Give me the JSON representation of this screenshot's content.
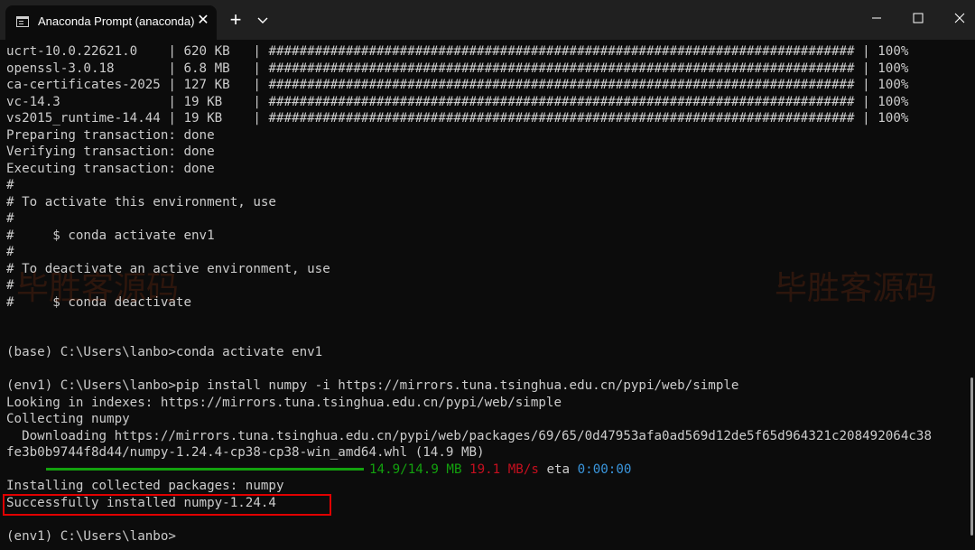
{
  "tab": {
    "title": "Anaconda Prompt (anaconda)",
    "close": "✕"
  },
  "titlebar": {
    "new_tab": "+"
  },
  "packages": [
    {
      "name": "ucrt-10.0.22621.0   ",
      "size": "620 KB   ",
      "bar": "############################################################################",
      "percent": "100%"
    },
    {
      "name": "openssl-3.0.18      ",
      "size": "6.8 MB   ",
      "bar": "############################################################################",
      "percent": "100%"
    },
    {
      "name": "ca-certificates-2025",
      "size": "127 KB   ",
      "bar": "############################################################################",
      "percent": "100%"
    },
    {
      "name": "vc-14.3             ",
      "size": "19 KB    ",
      "bar": "############################################################################",
      "percent": "100%"
    },
    {
      "name": "vs2015_runtime-14.44",
      "size": "19 KB    ",
      "bar": "############################################################################",
      "percent": "100%"
    }
  ],
  "lines": {
    "prep": "Preparing transaction: done",
    "verify": "Verifying transaction: done",
    "exec": "Executing transaction: done",
    "h1": "#",
    "h2": "# To activate this environment, use",
    "h3": "#",
    "h4": "#     $ conda activate env1",
    "h5": "#",
    "h6": "# To deactivate an active environment, use",
    "h7": "#",
    "h8": "#     $ conda deactivate",
    "cmd1": "(base) C:\\Users\\lanbo>conda activate env1",
    "cmd2": "(env1) C:\\Users\\lanbo>pip install numpy -i https://mirrors.tuna.tsinghua.edu.cn/pypi/web/simple",
    "looking": "Looking in indexes: https://mirrors.tuna.tsinghua.edu.cn/pypi/web/simple",
    "collecting": "Collecting numpy",
    "download1": "  Downloading https://mirrors.tuna.tsinghua.edu.cn/pypi/web/packages/69/65/0d47953afa0ad569d12de5f65d964321c208492064c38",
    "download2": "fe3b0b9744f8d44/numpy-1.24.4-cp38-cp38-win_amd64.whl (14.9 MB)",
    "installing": "Installing collected packages: numpy",
    "success": "Successfully installed numpy-1.24.4",
    "prompt": "(env1) C:\\Users\\lanbo>"
  },
  "progress": {
    "fraction": 1.0,
    "amount": "14.9/14.9 MB",
    "speed": "19.1 MB/s",
    "eta_label": "eta",
    "eta": "0:00:00"
  },
  "watermark": "毕胜客源码",
  "colors": {
    "progress": "#13a10e",
    "speed": "#c50f1f",
    "eta": "#3a96dd",
    "highlight_box": "#e00000"
  }
}
